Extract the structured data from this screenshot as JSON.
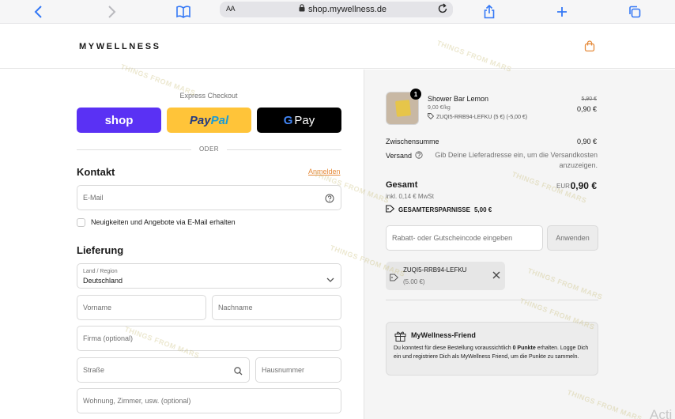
{
  "browser": {
    "aa_label": "AA",
    "url": "shop.mywellness.de"
  },
  "header": {
    "logo": "MYWELLNESS"
  },
  "express": {
    "label": "Express Checkout",
    "shop_label": "shop",
    "paypal_part1": "Pay",
    "paypal_part2": "Pal",
    "gpay_g": "G",
    "gpay_label": "Pay",
    "or_label": "ODER"
  },
  "contact": {
    "title": "Kontakt",
    "login_link": "Anmelden",
    "email_placeholder": "E-Mail",
    "newsletter_label": "Neuigkeiten und Angebote via E-Mail erhalten"
  },
  "delivery": {
    "title": "Lieferung",
    "country_label": "Land / Region",
    "country_value": "Deutschland",
    "first_name_placeholder": "Vorname",
    "last_name_placeholder": "Nachname",
    "company_placeholder": "Firma (optional)",
    "street_placeholder": "Straße",
    "house_number_placeholder": "Hausnummer",
    "apartment_placeholder": "Wohnung, Zimmer, usw. (optional)"
  },
  "cart": {
    "item": {
      "quantity": "1",
      "name": "Shower Bar Lemon",
      "unit_price": "9,00 €/kg",
      "discount": "ZUQI5-RRB94-LEFKU (5 €) (-5,00 €)",
      "old_price": "5,90 €",
      "price": "0,90 €"
    },
    "subtotal_label": "Zwischensumme",
    "subtotal_value": "0,90 €",
    "shipping_label": "Versand",
    "shipping_note": "Gib Deine Lieferadresse ein, um die Versandkosten anzuzeigen.",
    "total_label": "Gesamt",
    "total_currency": "EUR",
    "total_value": "0,90 €",
    "vat_note": "inkl. 0,14 € MwSt",
    "savings_label": "GESAMTERSPARNISSE",
    "savings_value": "5,00 €",
    "discount_placeholder": "Rabatt- oder Gutscheincode eingeben",
    "apply_label": "Anwenden",
    "applied_code": "ZUQI5-RRB94-LEFKU",
    "applied_amount": "(5.00 €)"
  },
  "friend": {
    "title": "MyWellness-Friend",
    "text_prefix": "Du konntest für diese Bestellung voraussichtlich ",
    "points": "0 Punkte",
    "text_suffix": " erhalten. Logge Dich ein und registriere Dich als MyWellness Friend, um die Punkte zu sammeln."
  },
  "watermark": "THINGS FROM MARS",
  "overlay_text": "Acti",
  "colors": {
    "shop_purple": "#5a31f4",
    "paypal_yellow": "#ffc439",
    "accent_orange": "#e58a3a",
    "summary_bg": "#f5f5f5"
  }
}
